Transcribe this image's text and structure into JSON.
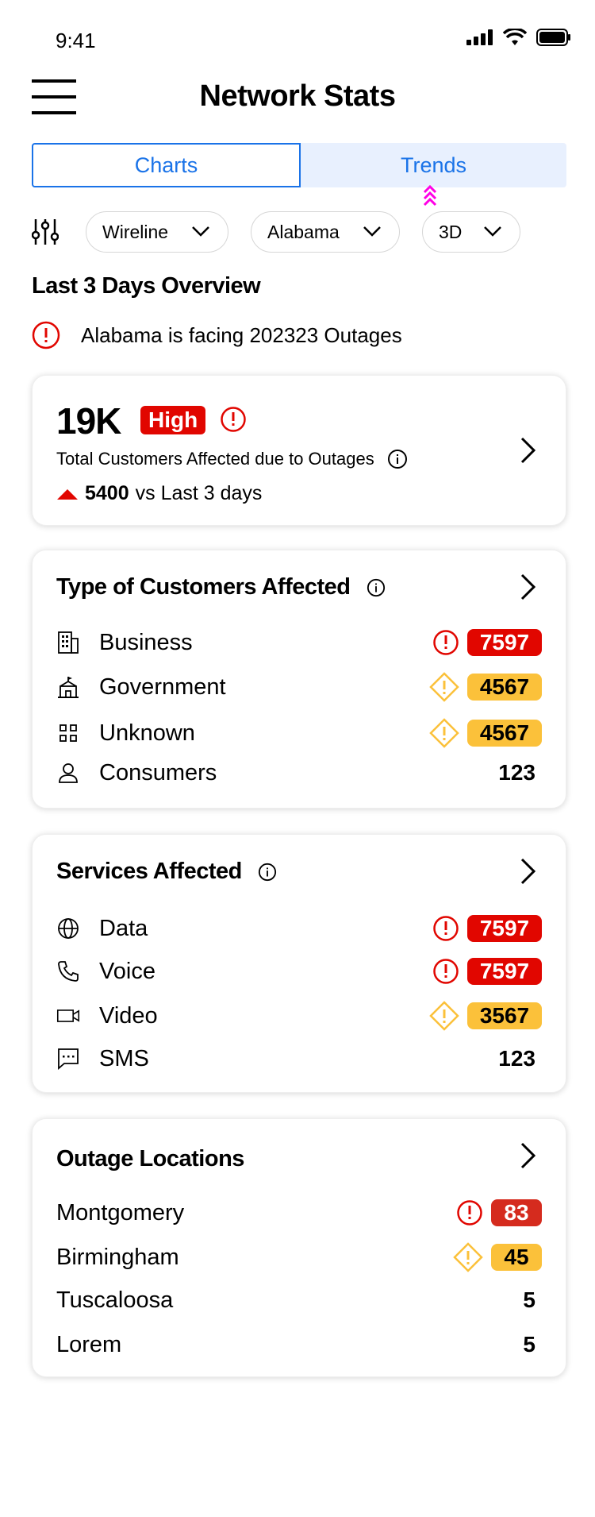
{
  "status_bar": {
    "time": "9:41"
  },
  "header": {
    "title": "Network Stats"
  },
  "tabs": [
    {
      "label": "Charts"
    },
    {
      "label": "Trends"
    }
  ],
  "filters": {
    "network": "Wireline",
    "state": "Alabama",
    "range": "3D"
  },
  "overview": {
    "title": "Last 3 Days Overview",
    "alert": "Alabama is facing 202323 Outages",
    "total": "19K",
    "severity": "High",
    "description": "Total Customers Affected due to Outages",
    "delta": "5400",
    "delta_suffix": "vs Last 3 days"
  },
  "customers": {
    "title": "Type of Customers Affected",
    "rows": [
      {
        "label": "Business",
        "value": "7597",
        "level": "critical"
      },
      {
        "label": "Government",
        "value": "4567",
        "level": "warning"
      },
      {
        "label": "Unknown",
        "value": "4567",
        "level": "warning"
      },
      {
        "label": "Consumers",
        "value": "123",
        "level": "normal"
      }
    ]
  },
  "services": {
    "title": "Services Affected",
    "rows": [
      {
        "label": "Data",
        "value": "7597",
        "level": "critical"
      },
      {
        "label": "Voice",
        "value": "7597",
        "level": "critical"
      },
      {
        "label": "Video",
        "value": "3567",
        "level": "warning"
      },
      {
        "label": "SMS",
        "value": "123",
        "level": "normal"
      }
    ]
  },
  "locations": {
    "title": "Outage Locations",
    "rows": [
      {
        "label": "Montgomery",
        "value": "83",
        "level": "critical"
      },
      {
        "label": "Birmingham",
        "value": "45",
        "level": "warning"
      },
      {
        "label": "Tuscaloosa",
        "value": "5",
        "level": "normal"
      },
      {
        "label": "Lorem",
        "value": "5",
        "level": "normal"
      }
    ]
  },
  "colors": {
    "critical": "#e10600",
    "warning": "#fbc13a",
    "accent": "#1a73e8"
  }
}
